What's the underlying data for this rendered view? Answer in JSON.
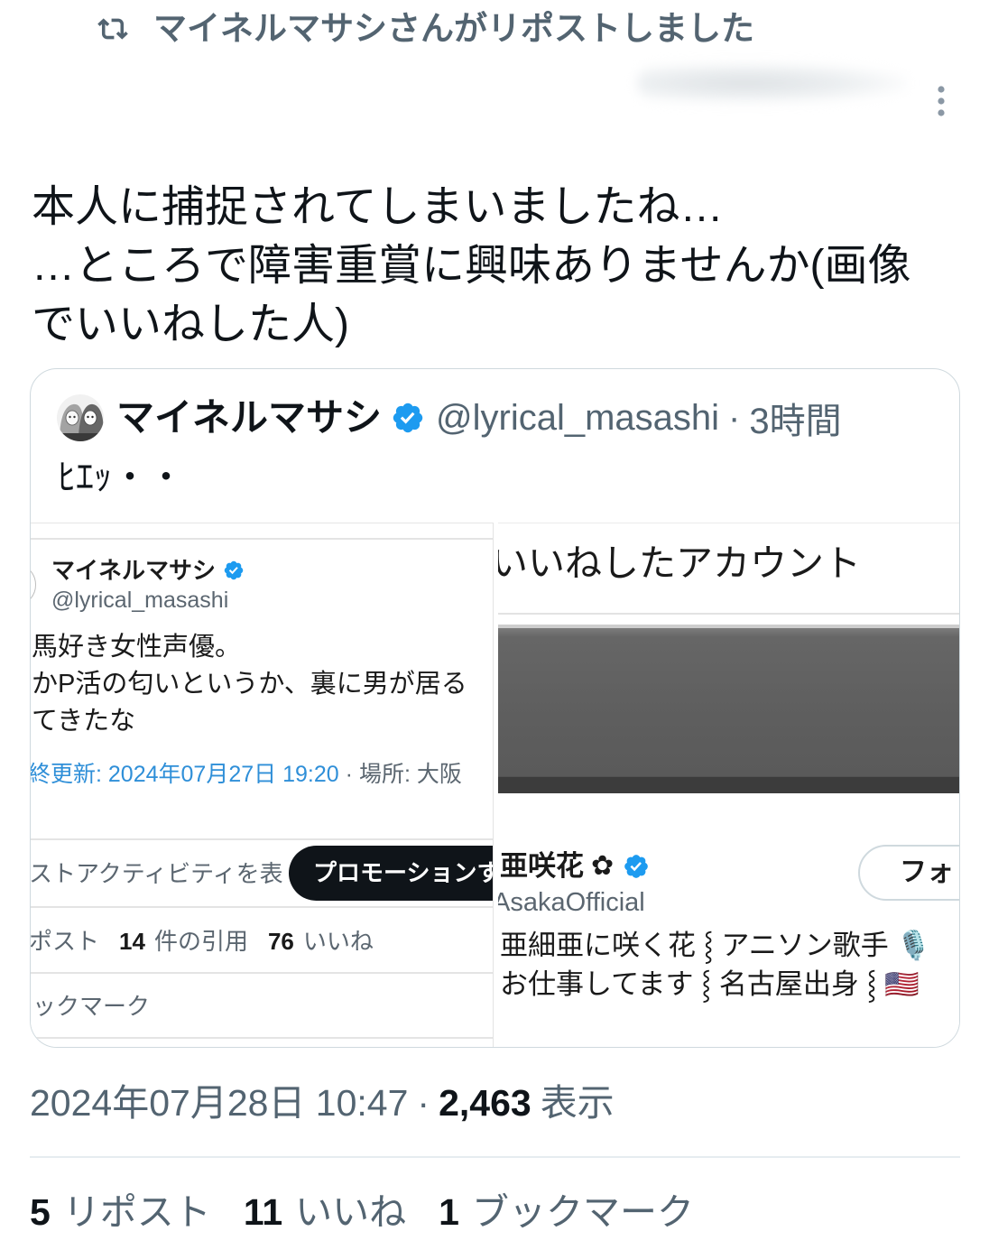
{
  "colors": {
    "text_primary": "#0f1419",
    "text_secondary": "#536471",
    "accent": "#1d9bf0",
    "border": "#cfd9de",
    "promo_button_bg": "#0f1419"
  },
  "repost_banner": {
    "icon": "repost-icon",
    "text": "マイネルマサシさんがリポストしました"
  },
  "post_header": {
    "menu_icon": "more-vertical-icon"
  },
  "tweet": {
    "text_lines": [
      "本人に捕捉されてしまいましたね…",
      "…ところで障害重賞に興味ありませんか(画像",
      "でいいねした人)"
    ]
  },
  "quote": {
    "author": {
      "name": "マイネルマサシ",
      "badge_icon": "verified-badge-icon",
      "handle": "@lyrical_masashi",
      "separator": "·",
      "time": "3時間"
    },
    "text": "ﾋｴｯ・・",
    "images": [
      {
        "profile": {
          "name": "マイネルマサシ",
          "badge_icon": "verified-badge-icon",
          "handle": "@lyrical_masashi",
          "bio_lines": [
            "馬好き女性声優。",
            "かP活の匂いというか、裏に男が居る",
            "てきたな"
          ],
          "last_updated": "終更新: 2024年07月27日 19:20",
          "meta_separator": "·",
          "location": "場所: 大阪"
        },
        "activity_label": "ストアクティビティを表",
        "promo_button": "プロモーションす",
        "stats": {
          "reposts_label": "ポスト",
          "quotes_count": "14",
          "quotes_label": "件の引用",
          "likes_count": "76",
          "likes_label": "いいね"
        },
        "bookmarks_label": "ックマーク"
      },
      {
        "title": "いいねしたアカウント",
        "account": {
          "name": "亜咲花",
          "emoji": "✿",
          "badge_icon": "verified-badge-icon",
          "handle": "AsakaOfficial",
          "follow_button": "フォ",
          "bio_lines": [
            "亜細亜に咲く花 ⸾ アニソン歌手 🎙️",
            "お仕事してます ⸾ 名古屋出身 ⸾ 🇺🇸"
          ]
        }
      }
    ]
  },
  "timestamp": {
    "datetime": "2024年07月28日 10:47",
    "separator": "·",
    "views_count": "2,463",
    "views_label": "表示"
  },
  "engagement": [
    {
      "count": "5",
      "label": "リポスト"
    },
    {
      "count": "11",
      "label": "いいね"
    },
    {
      "count": "1",
      "label": "ブックマーク"
    }
  ]
}
